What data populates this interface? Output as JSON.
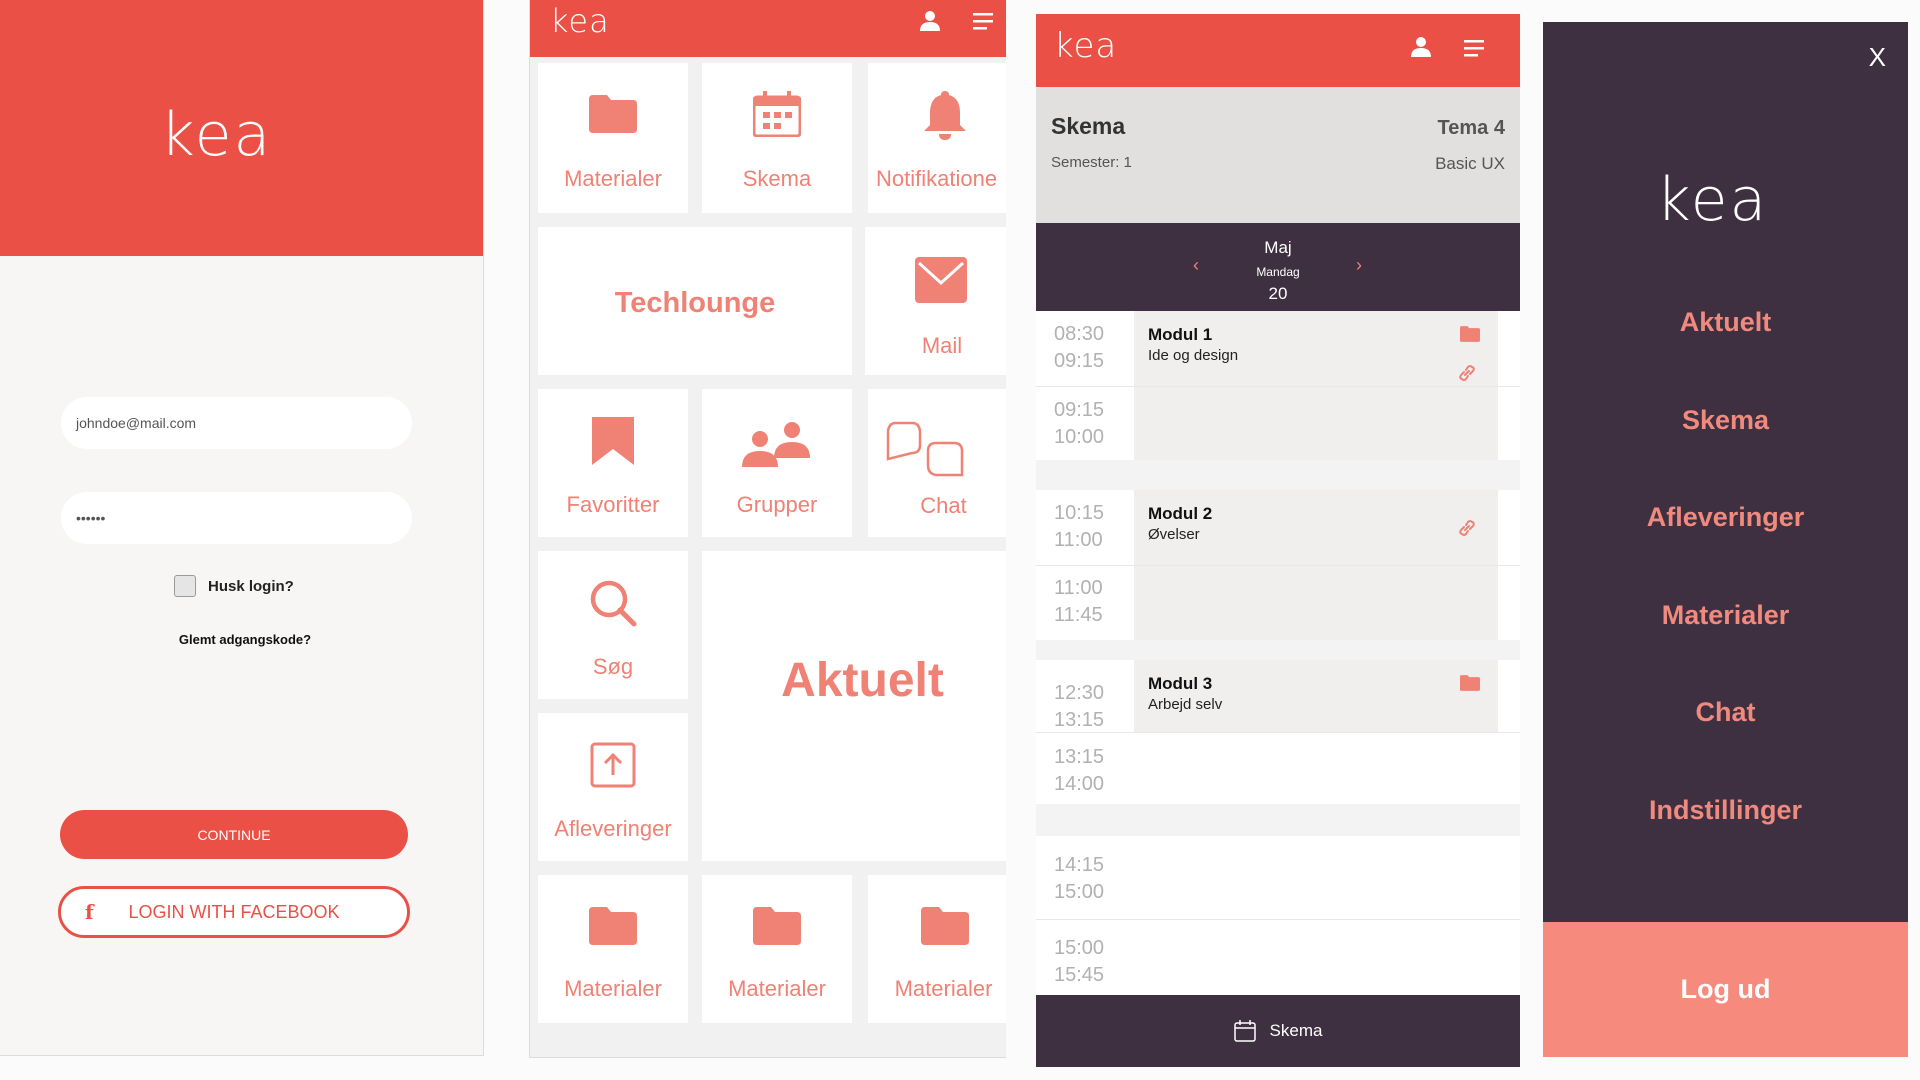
{
  "login": {
    "logo": "kea",
    "email_value": "johndoe@mail.com",
    "password_value": "••••••",
    "remember_label": "Husk login?",
    "forgot_label": "Glemt adgangskode?",
    "continue_label": "CONTINUE",
    "facebook_label": "LOGIN WITH FACEBOOK",
    "facebook_icon": "f"
  },
  "dashboard": {
    "logo": "kea",
    "tiles": {
      "materialer_top": "Materialer",
      "skema": "Skema",
      "notifikationer": "Notifikatione",
      "techlounge": "Techlounge",
      "mail": "Mail",
      "favoritter": "Favoritter",
      "grupper": "Grupper",
      "chat": "Chat",
      "sog": "Søg",
      "aktuelt": "Aktuelt",
      "afleveringer": "Afleveringer",
      "materialer_b1": "Materialer",
      "materialer_b2": "Materialer",
      "materialer_b3": "Materialer"
    }
  },
  "schedule": {
    "logo": "kea",
    "title": "Skema",
    "semester": "Semester: 1",
    "theme": "Tema 4",
    "course": "Basic UX",
    "month": "Maj",
    "weekday": "Mandag",
    "day": "20",
    "prev_arrow": "‹",
    "next_arrow": "›",
    "times": {
      "t1a": "08:30",
      "t1b": "09:15",
      "t2a": "09:15",
      "t2b": "10:00",
      "t3a": "10:15",
      "t3b": "11:00",
      "t4a": "11:00",
      "t4b": "11:45",
      "t5a": "12:30",
      "t5b": "13:15",
      "t6a": "13:15",
      "t6b": "14:00",
      "t7a": "14:15",
      "t7b": "15:00",
      "t8a": "15:00",
      "t8b": "15:45"
    },
    "modules": [
      {
        "title": "Modul 1",
        "subtitle": "Ide og design"
      },
      {
        "title": "Modul 2",
        "subtitle": "Øvelser"
      },
      {
        "title": "Modul 3",
        "subtitle": "Arbejd selv"
      }
    ],
    "bottom_label": "Skema"
  },
  "menu": {
    "close": "X",
    "logo": "kea",
    "items": [
      "Aktuelt",
      "Skema",
      "Afleveringer",
      "Materialer",
      "Chat",
      "Indstillinger"
    ],
    "logout": "Log ud"
  },
  "colors": {
    "brand_red": "#ea5046",
    "salmon": "#ef8175",
    "dark_purple": "#3e3040"
  }
}
